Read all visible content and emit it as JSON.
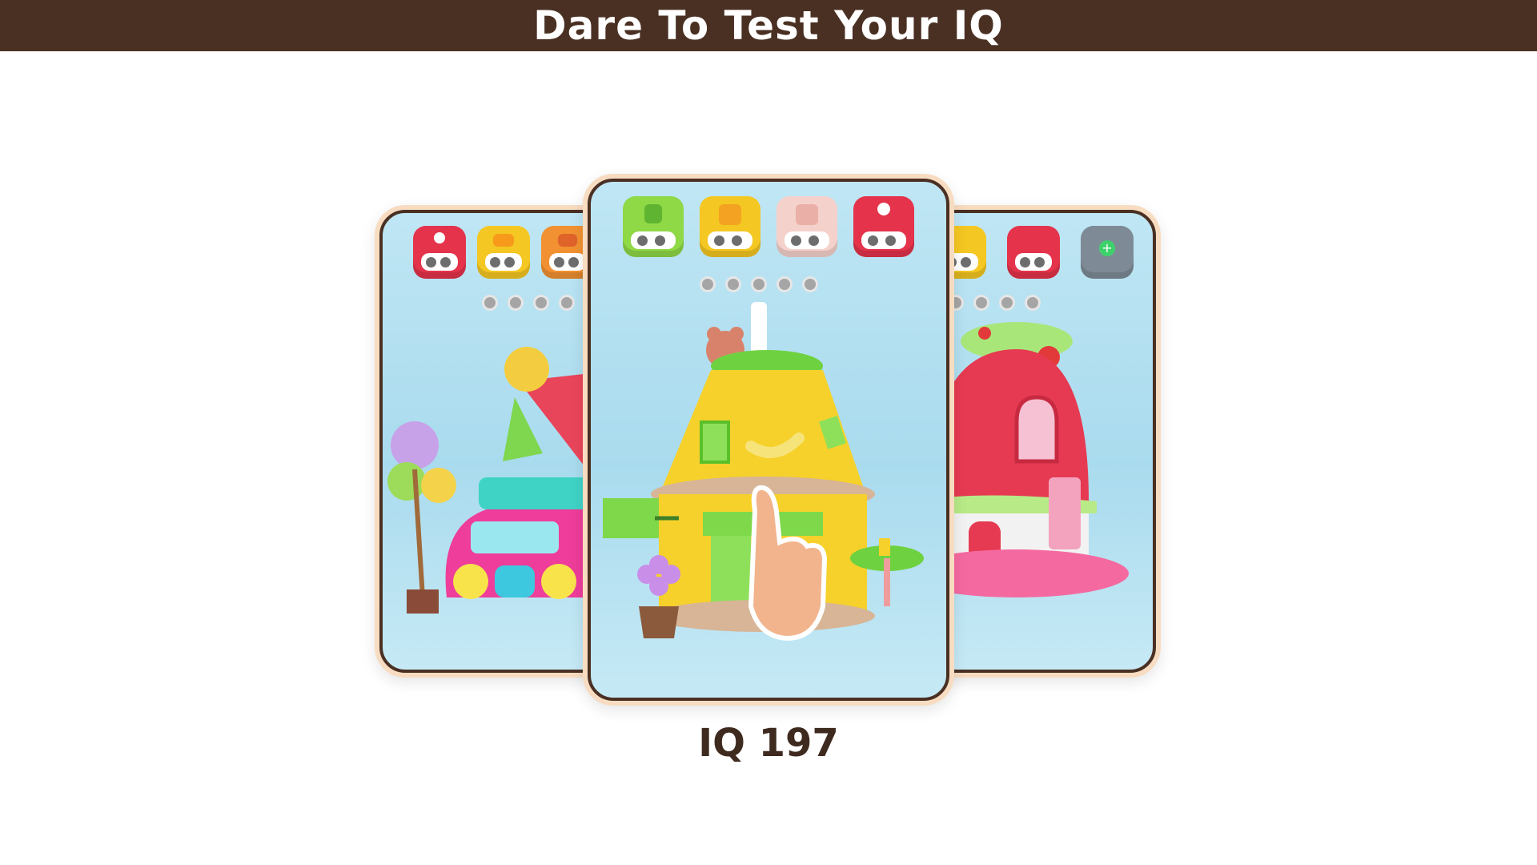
{
  "header": {
    "title": "Dare To Test Your IQ"
  },
  "result": {
    "label": "IQ 197"
  },
  "cards": [
    {
      "id": "left",
      "scene": "candy truck"
    },
    {
      "id": "center",
      "scene": "banana juice house"
    },
    {
      "id": "right",
      "scene": "strawberry house"
    }
  ],
  "colors": {
    "banner": "#4a3023",
    "card_frame": "#f7dcc1",
    "card_bg": "#a9dbee",
    "label_text": "#3e2a1f"
  }
}
